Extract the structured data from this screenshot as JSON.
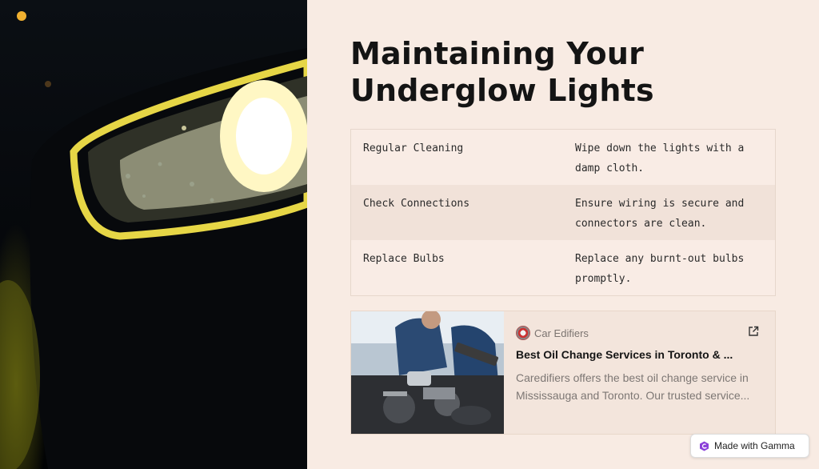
{
  "slide": {
    "title_line1": "Maintaining Your",
    "title_line2": "Underglow Lights"
  },
  "table": {
    "rows": [
      {
        "label": "Regular Cleaning",
        "detail": "Wipe down the lights with a damp cloth."
      },
      {
        "label": "Check Connections",
        "detail": "Ensure wiring is secure and connectors are clean."
      },
      {
        "label": "Replace Bulbs",
        "detail": "Replace any burnt-out bulbs promptly."
      }
    ]
  },
  "link_card": {
    "site_name": "Car Edifiers",
    "title": "Best Oil Change Services in Toronto & ...",
    "description": "Caredifiers offers the best oil change service in Mississauga and Toronto. Our trusted service..."
  },
  "badge": {
    "label": "Made with Gamma"
  },
  "colors": {
    "background": "#f8ebe3",
    "headlight": "#f2e24a",
    "badge_icon": "#8b3fd9"
  },
  "icons": [
    "site-favicon-icon",
    "external-link-icon",
    "gamma-logo-icon"
  ]
}
